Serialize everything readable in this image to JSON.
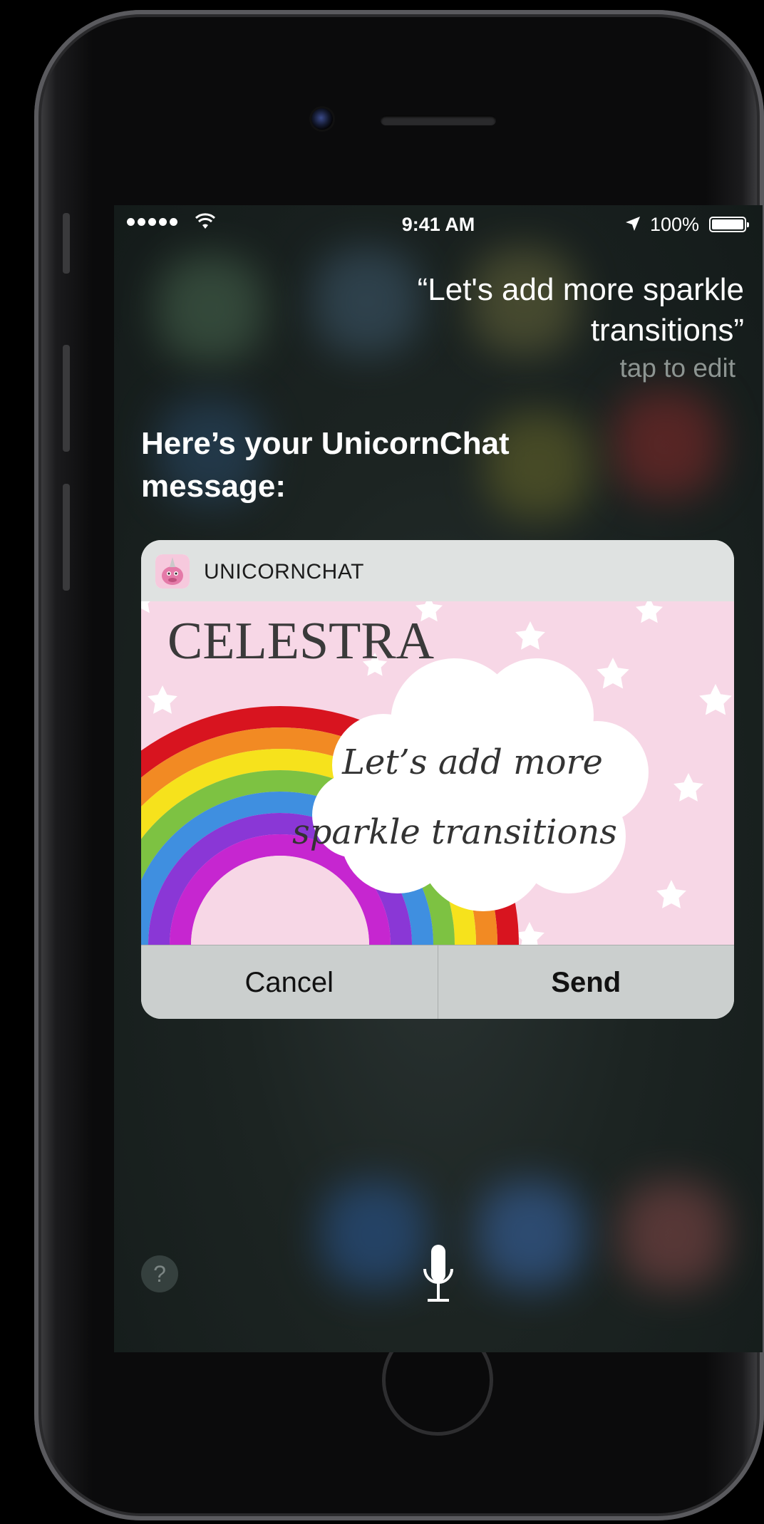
{
  "status_bar": {
    "time": "9:41 AM",
    "battery_percent": "100%",
    "signal_bars": 5,
    "icons": [
      "signal-dots-icon",
      "wifi-icon",
      "location-arrow-icon",
      "battery-icon"
    ]
  },
  "siri": {
    "utterance": "“Let's add more sparkle transitions”",
    "tap_to_edit": "tap to edit",
    "response": "Here’s your UnicornChat message:"
  },
  "card": {
    "app_name": "UNICORNCHAT",
    "image_title": "CELESTRA",
    "message_line1": "Let’s add more",
    "message_line2": "sparkle transitions",
    "cancel_label": "Cancel",
    "send_label": "Send",
    "colors": {
      "pink_background": "#f7d7e6",
      "rainbow": [
        "#d8141f",
        "#f28a23",
        "#f6e21c",
        "#7dc242",
        "#3f8fe0",
        "#8a37d6",
        "#c626d0"
      ]
    }
  },
  "bottom": {
    "help_label": "?",
    "icons": [
      "help-icon",
      "microphone-icon"
    ]
  }
}
